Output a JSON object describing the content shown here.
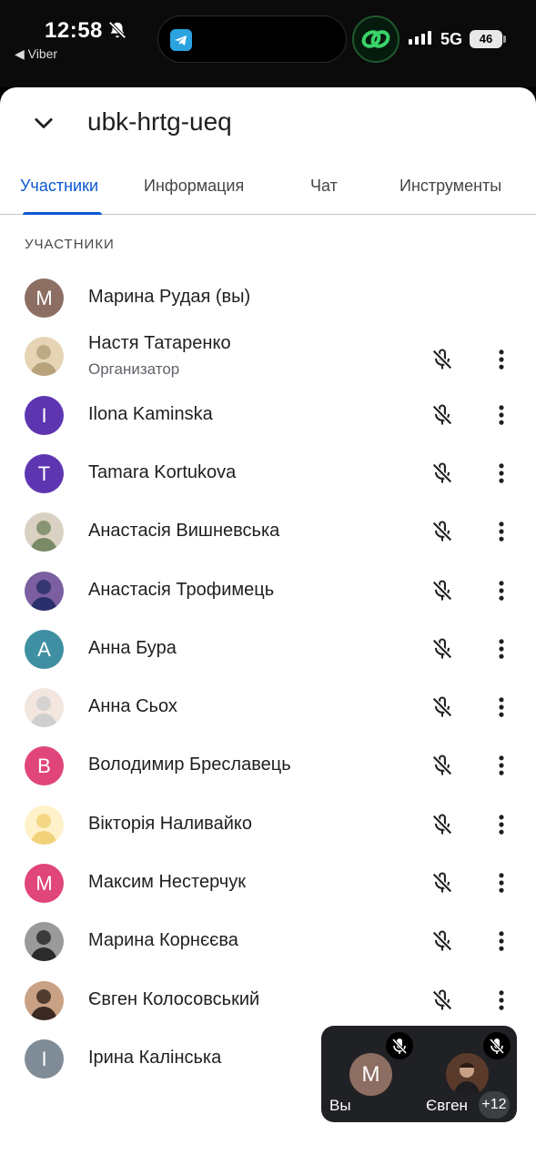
{
  "status_bar": {
    "time": "12:58",
    "back_app": "◀ Viber",
    "network": "5G",
    "battery": "46"
  },
  "header": {
    "meeting_code": "ubk-hrtg-ueq"
  },
  "tabs": [
    {
      "label": "Участники",
      "active": true
    },
    {
      "label": "Информация",
      "active": false
    },
    {
      "label": "Чат",
      "active": false
    },
    {
      "label": "Инструменты",
      "active": false
    }
  ],
  "section_label": "УЧАСТНИКИ",
  "participants": [
    {
      "name": "Марина Рудая (вы)",
      "initial": "М",
      "avatar_color": "#8d6e63",
      "photo": false,
      "controls": false
    },
    {
      "name": "Настя Татаренко",
      "role": "Организатор",
      "photo": true,
      "controls": true
    },
    {
      "name": "Ilona Kaminska",
      "initial": "I",
      "avatar_color": "#5e35b1",
      "photo": false,
      "controls": true
    },
    {
      "name": "Tamara Kortukova",
      "initial": "T",
      "avatar_color": "#5e35b1",
      "photo": false,
      "controls": true
    },
    {
      "name": "Анастасія Вишневська",
      "photo": true,
      "controls": true
    },
    {
      "name": "Анастасія Трофимець",
      "photo": true,
      "controls": true
    },
    {
      "name": "Анна Бура",
      "initial": "A",
      "avatar_color": "#3f8fa3",
      "photo": false,
      "controls": true
    },
    {
      "name": "Анна Сьох",
      "photo": true,
      "controls": true
    },
    {
      "name": "Володимир Бреславець",
      "initial": "B",
      "avatar_color": "#e0457b",
      "photo": false,
      "controls": true
    },
    {
      "name": "Вікторія Наливайко",
      "photo": true,
      "controls": true
    },
    {
      "name": "Максим Нестерчук",
      "initial": "M",
      "avatar_color": "#e0457b",
      "photo": false,
      "controls": true
    },
    {
      "name": "Марина Корнєєва",
      "photo": true,
      "controls": true
    },
    {
      "name": "Євген Колосовський",
      "photo": true,
      "controls": true
    },
    {
      "name": "Ірина Калінська",
      "initial": "I",
      "avatar_color": "#7f8c97",
      "photo": false,
      "controls": false
    }
  ],
  "pip": {
    "self_label": "Вы",
    "self_initial": "М",
    "other_label": "Євген",
    "more_count": "+12"
  }
}
